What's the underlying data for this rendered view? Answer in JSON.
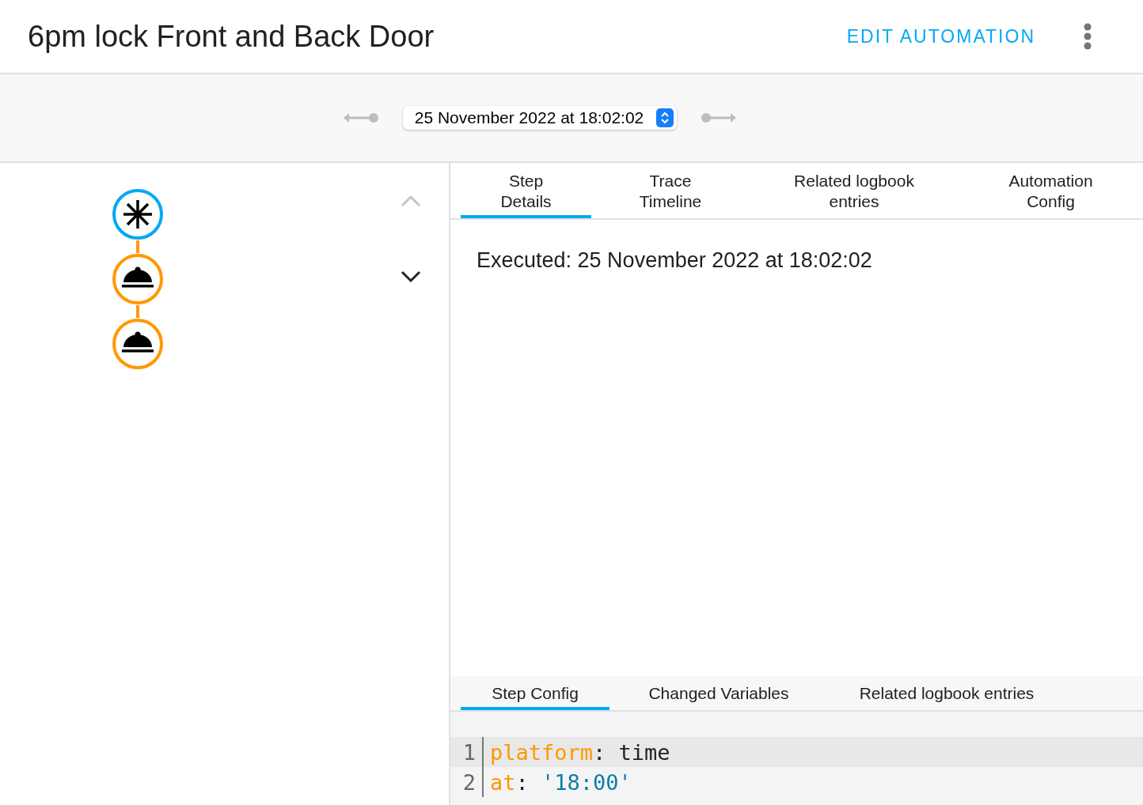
{
  "header": {
    "title": "6pm lock Front and Back Door",
    "edit_button": "EDIT AUTOMATION"
  },
  "trace_picker": {
    "value": "25 November 2022 at 18:02:02",
    "previous_disabled": true,
    "next_disabled": true
  },
  "graph": {
    "nodes": [
      {
        "kind": "trigger"
      },
      {
        "kind": "action"
      },
      {
        "kind": "action"
      }
    ],
    "up_disabled": true,
    "down_disabled": false
  },
  "tabs": [
    {
      "label": "Step\nDetails",
      "selected": true
    },
    {
      "label": "Trace\nTimeline",
      "selected": false
    },
    {
      "label": "Related logbook\nentries",
      "selected": false
    },
    {
      "label": "Automation\nConfig",
      "selected": false
    }
  ],
  "executed": "Executed: 25 November 2022 at 18:02:02",
  "sub_tabs": [
    {
      "label": "Step Config",
      "selected": true
    },
    {
      "label": "Changed Variables",
      "selected": false
    },
    {
      "label": "Related logbook entries",
      "selected": false
    }
  ],
  "code": {
    "lines": [
      {
        "number": "1",
        "active": true,
        "tokens": [
          {
            "kind": "key",
            "text": "platform"
          },
          {
            "kind": "punct",
            "text": ": "
          },
          {
            "kind": "plain",
            "text": "time"
          }
        ]
      },
      {
        "number": "2",
        "active": false,
        "tokens": [
          {
            "kind": "key",
            "text": "at"
          },
          {
            "kind": "punct",
            "text": ": "
          },
          {
            "kind": "string",
            "text": "'18:00'"
          }
        ]
      }
    ]
  }
}
